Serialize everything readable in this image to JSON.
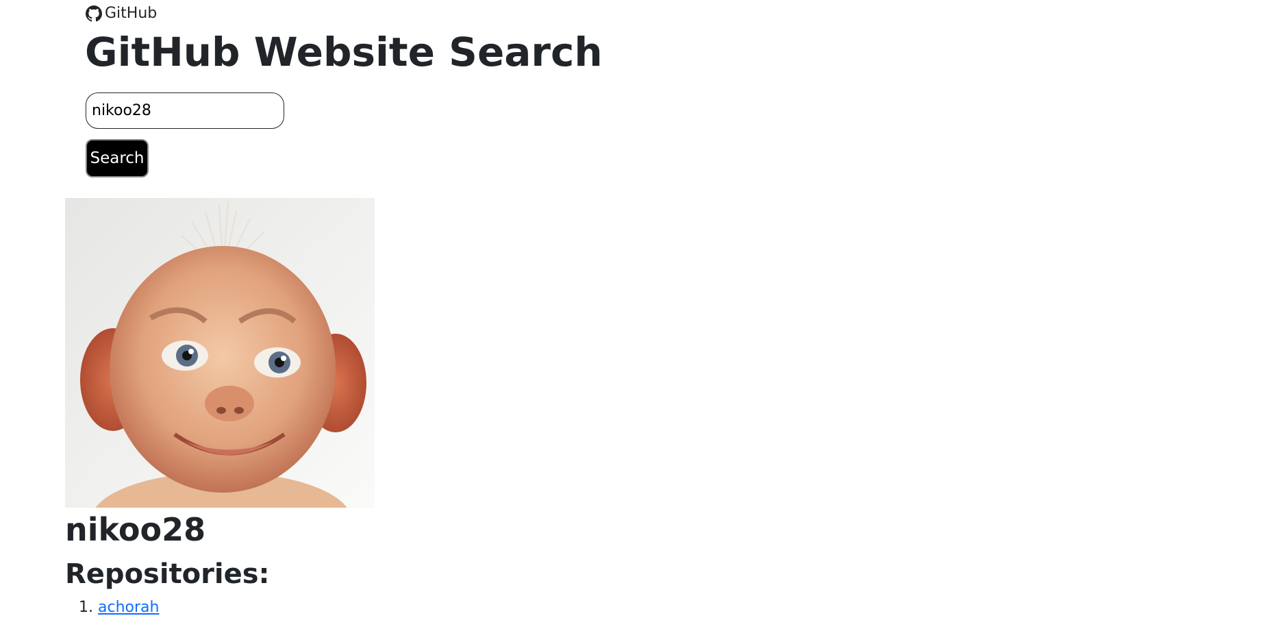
{
  "header": {
    "brand_label": "GitHub",
    "brand_icon": "github-icon",
    "title": "GitHub Website Search"
  },
  "search": {
    "value": "nikoo28",
    "button_label": "Search"
  },
  "profile": {
    "avatar_description": "user avatar",
    "username": "nikoo28",
    "repos_heading": "Repositories:",
    "repositories": [
      {
        "number": "1.",
        "name": "achorah"
      }
    ]
  },
  "colors": {
    "text": "#212529",
    "link": "#0d6efd",
    "button_bg": "#000000",
    "button_text": "#ffffff"
  }
}
